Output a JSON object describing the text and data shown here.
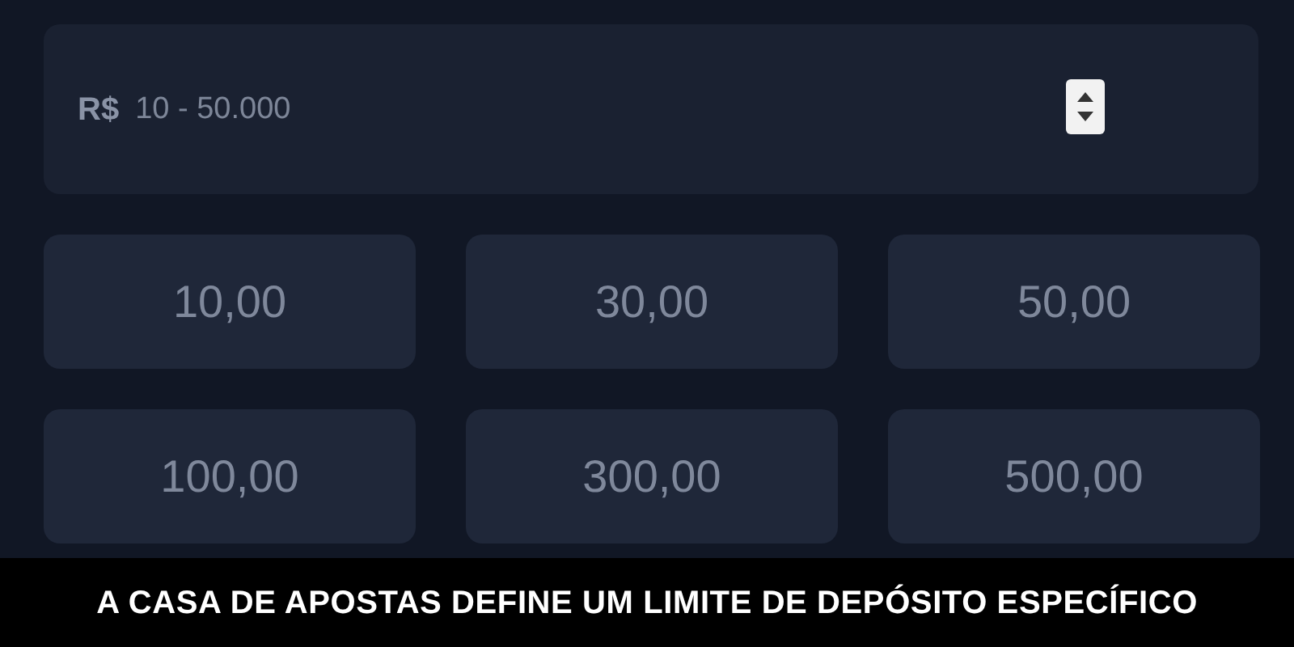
{
  "amount_field": {
    "currency": "R$",
    "placeholder": "10 - 50.000"
  },
  "quick_amounts": [
    "10,00",
    "30,00",
    "50,00",
    "100,00",
    "300,00",
    "500,00"
  ],
  "caption": "A CASA DE APOSTAS DEFINE UM LIMITE DE DEPÓSITO ESPECÍFICO"
}
